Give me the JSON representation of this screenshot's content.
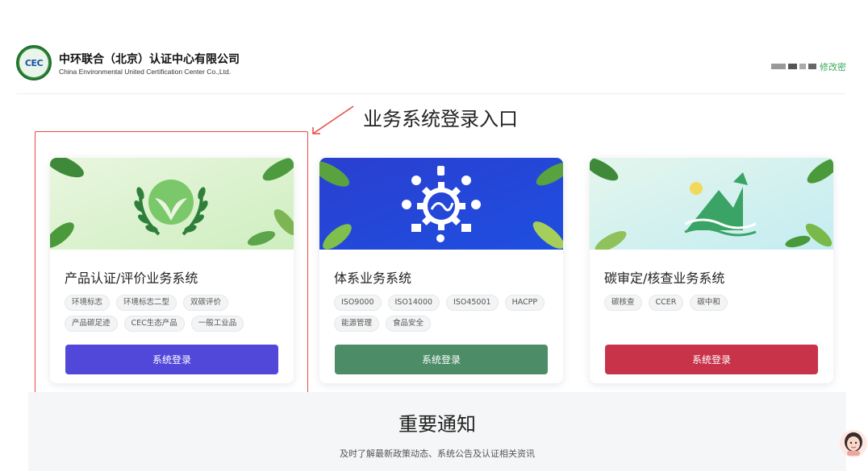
{
  "header": {
    "logo_text": "CEC",
    "company_cn": "中环联合（北京）认证中心有限公司",
    "company_en": "China Environmental United Certification Center Co.,Ltd.",
    "change_password": "修改密"
  },
  "annotation": {
    "text": "业务系统登录入口"
  },
  "cards": [
    {
      "title": "产品认证/评价业务系统",
      "tags": [
        "环境标志",
        "环境标志二型",
        "双碳评价",
        "产品碳足迹",
        "CEC生态产品",
        "一般工业品"
      ],
      "button": "系统登录",
      "button_color": "#5147d9"
    },
    {
      "title": "体系业务系统",
      "tags": [
        "ISO9000",
        "ISO14000",
        "ISO45001",
        "HACPP",
        "能源管理",
        "食品安全"
      ],
      "button": "系统登录",
      "button_color": "#4c8c67"
    },
    {
      "title": "碳审定/核查业务系统",
      "tags": [
        "碳核查",
        "CCER",
        "碳中和"
      ],
      "button": "系统登录",
      "button_color": "#c8334a"
    }
  ],
  "notice": {
    "title": "重要通知",
    "subtitle": "及时了解最新政策动态、系统公告及认证相关资讯"
  }
}
